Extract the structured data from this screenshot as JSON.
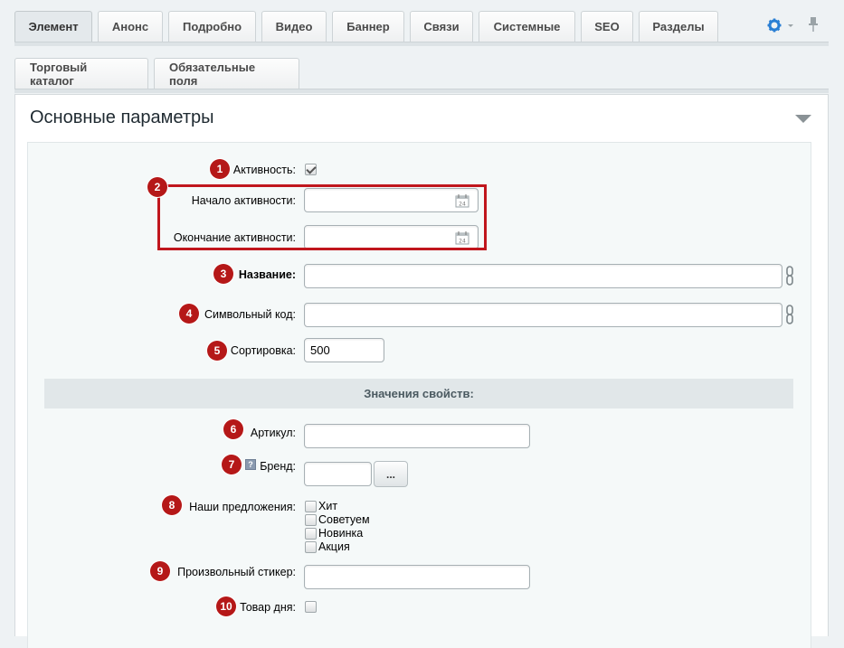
{
  "tabs_main": [
    "Элемент",
    "Анонс",
    "Подробно",
    "Видео",
    "Баннер",
    "Связи",
    "Системные",
    "SEO",
    "Разделы"
  ],
  "tabs_sub": [
    "Торговый каталог",
    "Обязательные поля"
  ],
  "icons": {
    "settings": "gear-icon",
    "pin": "pin-icon",
    "calendar": "calendar-icon",
    "link": "chain-link-icon",
    "collapse": "triangle-down-icon",
    "help": "help-icon"
  },
  "colors": {
    "badge": "#b51818",
    "highlight_box": "#c0161d",
    "gear": "#2a7fd4"
  },
  "panel": {
    "title": "Основные параметры"
  },
  "fields": {
    "active": {
      "label": "Активность:",
      "checked": true
    },
    "start": {
      "label": "Начало активности:",
      "value": ""
    },
    "end": {
      "label": "Окончание активности:",
      "value": ""
    },
    "name": {
      "label": "Название:",
      "value": ""
    },
    "code": {
      "label": "Символьный код:",
      "value": ""
    },
    "sort": {
      "label": "Сортировка:",
      "value": "500"
    }
  },
  "properties": {
    "header": "Значения свойств:",
    "article": {
      "label": "Артикул:",
      "value": ""
    },
    "brand": {
      "label": "Бренд:",
      "value": "",
      "button": "..."
    },
    "offers": {
      "label": "Наши предложения:",
      "options": [
        "Хит",
        "Советуем",
        "Новинка",
        "Акция"
      ]
    },
    "sticker": {
      "label": "Произвольный стикер:",
      "value": ""
    },
    "deal_of_day": {
      "label": "Товар дня:",
      "checked": false
    }
  },
  "badges": [
    "1",
    "2",
    "3",
    "4",
    "5",
    "6",
    "7",
    "8",
    "9",
    "10"
  ]
}
